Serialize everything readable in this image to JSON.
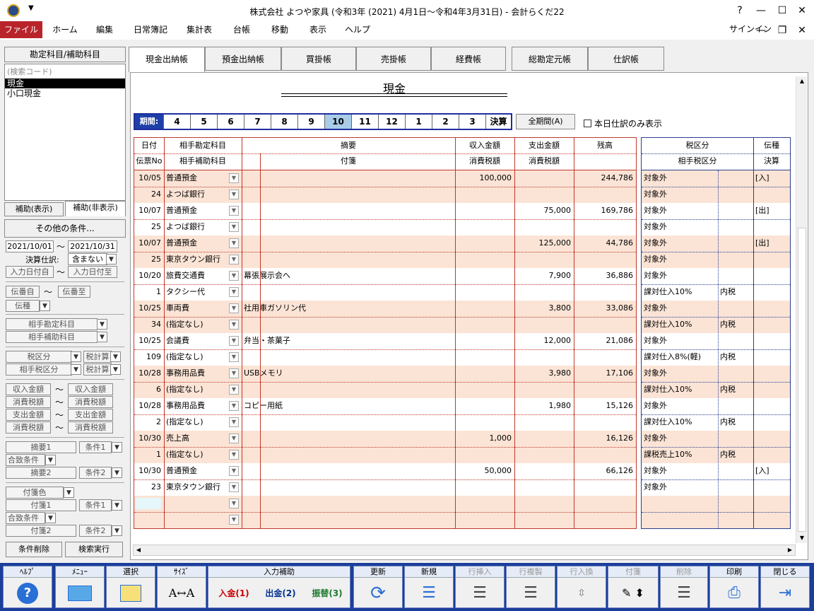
{
  "window": {
    "title": "株式会社 よつや家具 (令和3年 (2021) 4月1日～令和4年3月31日) - 会計らくだ22",
    "help": "?",
    "minimize": "—",
    "maximize": "☐",
    "close": "✕"
  },
  "menu": {
    "items": [
      "ファイル",
      "ホーム",
      "編集",
      "日常簿記",
      "集計表",
      "台帳",
      "移動",
      "表示",
      "ヘルプ"
    ],
    "signin": "サインイン"
  },
  "left": {
    "header": "勘定科目/補助科目",
    "search_placeholder": "(検索コード)",
    "accounts": [
      "現金",
      "小口現金"
    ],
    "sub_show": "補助(表示)",
    "sub_hide": "補助(非表示)",
    "other_cond": "その他の条件...",
    "date_from": "2021/10/01",
    "date_to": "2021/10/31",
    "tilde": "～",
    "kessan_label": "決算仕訳:",
    "kessan_value": "含まない",
    "input_from": "入力日付自",
    "input_to": "入力日付至",
    "den_from": "伝番自",
    "den_to": "伝番至",
    "denshu": "伝種",
    "aite_kamoku": "相手勘定科目",
    "aite_hojo": "相手補助科目",
    "zei_kubun": "税区分",
    "zei_sub": "税計算",
    "aite_zei": "相手税区分",
    "aite_zei_sub": "税計算",
    "shunyu": "収入金額",
    "shohi1": "消費税額",
    "shishutsu": "支出金額",
    "shohi2": "消費税額",
    "tekiyo1": "摘要1",
    "joken1": "条件1",
    "icchi1": "合致条件",
    "tekiyo2": "摘要2",
    "joken2": "条件2",
    "fusen_color": "付箋色",
    "fusen1": "付箋1",
    "fjoken1": "条件1",
    "ficchi": "合致条件",
    "fusen2": "付箋2",
    "fjoken2": "条件2",
    "clear": "条件削除",
    "search": "検索実行"
  },
  "tabs": [
    "現金出納帳",
    "預金出納帳",
    "買掛帳",
    "売掛帳",
    "経費帳",
    "総勘定元帳",
    "仕訳帳"
  ],
  "ledger_title": "現金",
  "period": {
    "label": "期間:",
    "months": [
      "4",
      "5",
      "6",
      "7",
      "8",
      "9",
      "10",
      "11",
      "12",
      "1",
      "2",
      "3"
    ],
    "kessan": "決算",
    "selected": "10"
  },
  "all_period": "全期間(A)",
  "today_only": "本日仕訳のみ表示",
  "headers": {
    "date": "日付",
    "slip": "伝票No",
    "account": "相手勘定科目",
    "subaccount": "相手補助科目",
    "memo": "摘要",
    "note": "付箋",
    "income": "収入金額",
    "income_tax": "消費税額",
    "expense": "支出金額",
    "expense_tax": "消費税額",
    "balance": "残高",
    "tax": "税区分",
    "aite_tax": "相手税区分",
    "type": "伝種",
    "settle": "決算"
  },
  "rows": [
    {
      "date": "10/05",
      "no": "24",
      "acct": "普通預金",
      "sub": "よつば銀行",
      "memo": "",
      "income": "100,000",
      "expense": "",
      "balance": "244,786",
      "tax": "対象外",
      "tax2": "対象外",
      "incl": "",
      "type": "[入]",
      "shade": true
    },
    {
      "date": "10/07",
      "no": "25",
      "acct": "普通預金",
      "sub": "よつば銀行",
      "memo": "",
      "income": "",
      "expense": "75,000",
      "balance": "169,786",
      "tax": "対象外",
      "tax2": "対象外",
      "incl": "",
      "type": "[出]",
      "shade": false
    },
    {
      "date": "10/07",
      "no": "25",
      "acct": "普通預金",
      "sub": "東京タウン銀行",
      "memo": "",
      "income": "",
      "expense": "125,000",
      "balance": "44,786",
      "tax": "対象外",
      "tax2": "対象外",
      "incl": "",
      "type": "[出]",
      "shade": true
    },
    {
      "date": "10/20",
      "no": "1",
      "acct": "旅費交通費",
      "sub": "タクシー代",
      "memo": "幕張展示会へ",
      "income": "",
      "expense": "7,900",
      "balance": "36,886",
      "tax": "対象外",
      "tax2": "課対仕入10%",
      "incl": "内税",
      "type": "",
      "shade": false
    },
    {
      "date": "10/25",
      "no": "34",
      "acct": "車両費",
      "sub": "(指定なし)",
      "memo": "社用車ガソリン代",
      "income": "",
      "expense": "3,800",
      "balance": "33,086",
      "tax": "対象外",
      "tax2": "課対仕入10%",
      "incl": "内税",
      "type": "",
      "shade": true
    },
    {
      "date": "10/25",
      "no": "109",
      "acct": "会議費",
      "sub": "(指定なし)",
      "memo": "弁当・茶菓子",
      "income": "",
      "expense": "12,000",
      "balance": "21,086",
      "tax": "対象外",
      "tax2": "課対仕入8%(軽)",
      "incl": "内税",
      "type": "",
      "shade": false
    },
    {
      "date": "10/28",
      "no": "6",
      "acct": "事務用品費",
      "sub": "(指定なし)",
      "memo": "USBメモリ",
      "income": "",
      "expense": "3,980",
      "balance": "17,106",
      "tax": "対象外",
      "tax2": "課対仕入10%",
      "incl": "内税",
      "type": "",
      "shade": true
    },
    {
      "date": "10/28",
      "no": "2",
      "acct": "事務用品費",
      "sub": "(指定なし)",
      "memo": "コピー用紙",
      "income": "",
      "expense": "1,980",
      "balance": "15,126",
      "tax": "対象外",
      "tax2": "課対仕入10%",
      "incl": "内税",
      "type": "",
      "shade": false
    },
    {
      "date": "10/30",
      "no": "1",
      "acct": "売上高",
      "sub": "(指定なし)",
      "memo": "",
      "income": "1,000",
      "expense": "",
      "balance": "16,126",
      "tax": "対象外",
      "tax2": "課税売上10%",
      "incl": "内税",
      "type": "",
      "shade": true
    },
    {
      "date": "10/30",
      "no": "23",
      "acct": "普通預金",
      "sub": "東京タウン銀行",
      "memo": "",
      "income": "50,000",
      "expense": "",
      "balance": "66,126",
      "tax": "対象外",
      "tax2": "対象外",
      "incl": "",
      "type": "[入]",
      "shade": false
    }
  ],
  "toolbar": {
    "help": "ﾍﾙﾌﾟ",
    "menu": "ﾒﾆｭｰ",
    "select": "選択",
    "size": "ｻｲｽﾞ",
    "input_assist": "入力補助",
    "nyukin": "入金(1)",
    "shukkin": "出金(2)",
    "furikae": "振替(3)",
    "update": "更新",
    "new": "新規",
    "insert": "行挿入",
    "copy": "行複製",
    "swap": "行入換",
    "fusen": "付箋",
    "delete": "削除",
    "print": "印刷",
    "close": "閉じる"
  },
  "colors": {
    "shade": "#fbe4d6",
    "red_grid": "#c0392b",
    "blue_grid": "#2c3e90",
    "file_menu": "#b8242a",
    "toolbar": "#1a3e9a"
  }
}
